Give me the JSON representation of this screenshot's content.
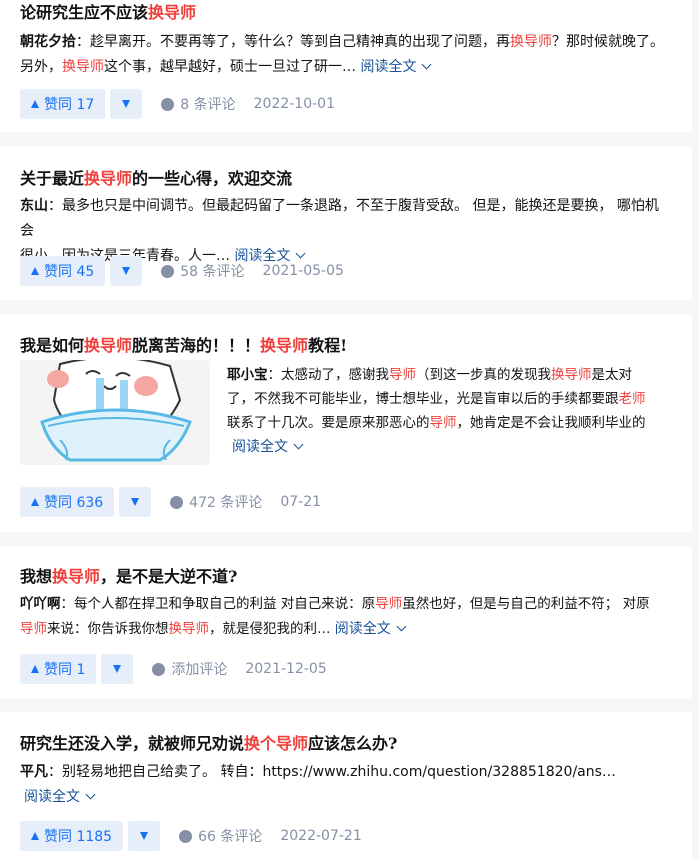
{
  "colors": {
    "highlight": "#f1403c",
    "accent": "#1772f6",
    "link": "#175199",
    "muted": "#8590a6"
  },
  "cards": [
    {
      "title_pre": "论研究生应不应该",
      "title_hl1": "换导师",
      "title_mid": "",
      "title_hl2": "",
      "title_post": "",
      "author": "朝花夕拾",
      "line1_pre": "：趁早离开。不要再等了，等什么？等到自己精神真的出现了问题，再",
      "line1_hl": "换导师",
      "line1_post": "？那时候就晚了。",
      "line2_pre": "另外，",
      "line2_hl": "换导师",
      "line2_post": "这个事，越早越好，硕士一旦过了研一… ",
      "read_more": "阅读全文",
      "votes": "赞同 17",
      "comments": "8 条评论",
      "date": "2022-10-01"
    },
    {
      "title_pre": "关于最近",
      "title_hl1": "换导师",
      "title_mid": "",
      "title_hl2": "",
      "title_post": "的一些心得，欢迎交流",
      "author": "东山",
      "line1_pre": "：最多也只是中间调节。但最起码留了一条退路，不至于腹背受敌。 但是，能换还是要换， 哪怕机会",
      "line1_hl": "",
      "line1_post": "",
      "line2_pre": "很小，因为这是三年青春。人一… ",
      "line2_hl": "",
      "line2_post": "",
      "read_more": "阅读全文",
      "votes": "赞同 45",
      "comments": "58 条评论",
      "date": "2021-05-05"
    },
    {
      "title_pre": "我是如何",
      "title_hl1": "换导师",
      "title_mid": "脱离苦海的！！！",
      "title_hl2": "换导师",
      "title_post": "教程!",
      "author": "耶小宝",
      "line1_pre": "：太感动了，感谢我",
      "line1_hl": "导师",
      "line1_mid": "（到这一步真的发现我",
      "line1_hl2": "换导师",
      "line1_post": "是太对",
      "line2_pre": "了，不然我不可能毕业，博士想毕业，光是盲审以后的手续都要跟",
      "line2_hl": "老师",
      "line2_post": "",
      "line3_pre": "联系了十几次。要是原来那恶心的",
      "line3_hl": "导师",
      "line3_post": "，她肯定是不会让我顺利毕业的",
      "read_more": "阅读全文",
      "votes": "赞同 636",
      "comments": "472 条评论",
      "date": "07-21",
      "image_alt": "crying-meme"
    },
    {
      "title_pre": "我想",
      "title_hl1": "换导师",
      "title_mid": "",
      "title_hl2": "",
      "title_post": "，是不是大逆不道?",
      "author": "吖吖啊",
      "line1_pre": "：每个人都在捍卫和争取自己的利益 对自己来说：原",
      "line1_hl": "导师",
      "line1_post": "虽然也好，但是与自己的利益不符； 对原",
      "line2_pre": "",
      "line2_hl": "导师",
      "line2_mid": "来说：你告诉我你想",
      "line2_hl2": "换导师",
      "line2_post": "，就是侵犯我的利… ",
      "read_more": "阅读全文",
      "votes": "赞同 1",
      "comments": "添加评论",
      "date": "2021-12-05"
    },
    {
      "title_pre": "研究生还没入学，就被师兄劝说",
      "title_hl1": "换个导师",
      "title_mid": "",
      "title_hl2": "",
      "title_post": "应该怎么办?",
      "author": "平凡",
      "line1_pre": "：别轻易地把自己给卖了。 转自：https://www.zhihu.com/question/328851820/ans…",
      "line1_hl": "",
      "line1_post": "",
      "read_more": "阅读全文",
      "votes": "赞同 1185",
      "comments": "66 条评论",
      "date": "2022-07-21"
    }
  ]
}
